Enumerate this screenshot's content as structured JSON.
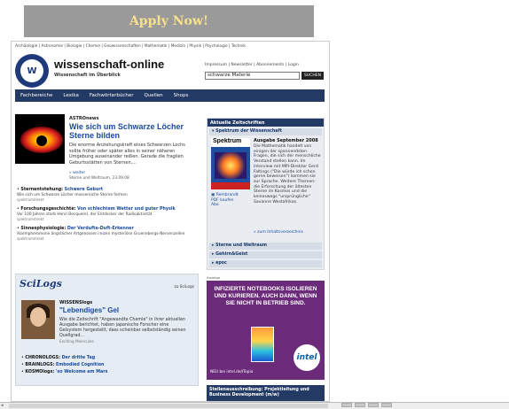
{
  "banner": {
    "label": "Apply Now!"
  },
  "top_links": "Archäologie | Astronomie | Biologie | Chemie | Geowissenschaften | Mathematik | Medizin | Physik | Psychologie | Technik",
  "brand": {
    "logo_letter": "W",
    "name": "wissenschaft-online",
    "tagline": "Wissenschaft im Überblick"
  },
  "util_links": "Impressum | Newsletter | Abonnements | Login",
  "search": {
    "value": "schwarze Materie",
    "button": "SUCHEN"
  },
  "nav": [
    "Fachbereiche",
    "Lexika",
    "Fachwörterbücher",
    "Quellen",
    "Shops"
  ],
  "astro": {
    "section": "ASTROnews",
    "headline": "Wie sich um Schwarze Löcher Sterne bilden",
    "teaser": "Die enorme Anziehungskraft eines Schwarzen Lochs sollte früher oder später alles in seiner näheren Umgebung auseinander reißen. Gerade die fragilen Geburtsstätten von Sternen,...",
    "more": "» weiter",
    "source": "Sterne und Weltraum, 23.09.08"
  },
  "news": [
    {
      "category": "Sternentstehung:",
      "title": "Schwere Geburt",
      "desc": "Wie sich um Schwarze Löcher massereiche Sterne formen",
      "source": "spektrumdirekt"
    },
    {
      "category": "Forschungsgeschichte:",
      "title": "Von schlechtem Wetter und guter Physik",
      "desc": "Vor 100 Jahren starb Henri Becquerel, der Entdecker der Radioaktivität",
      "source": "spektrumdirekt"
    },
    {
      "category": "Sinnesphysiologie:",
      "title": "Der Verdufte-Duft-Erkenner",
      "desc": "Alarmpheromone ängstlicher Artgenossen reizen mysteriöse Gruenebergs-Nervenzellen",
      "source": "spektrumdirekt"
    }
  ],
  "sidebar": {
    "title": "Aktuelle Zeitschriften",
    "active": "Spektrum der Wissenschaft",
    "mag_brand": "Spektrum",
    "issue": "Ausgabe September 2008",
    "desc": "Die Mathematik handelt von einigen der spannendsten Fragen, die sich der menschliche Verstand stellen kann. Im Interview mit MPI-Direktor Gerd Faltings (\"Die würde ich schon gerne beweisen\") kommen sie zur Sprache. Weitere Themen: die Erforschung der ältesten Sterne im Kosmos und die keineswegs \"ursprüngliche\" Savanne Westafrikas.",
    "links": [
      "Rembrandt",
      "PDF kaufen",
      "Abo"
    ],
    "toc": "» zum Inhaltsverzeichnis",
    "others": [
      "Sterne und Weltraum",
      "Gehirn&Geist",
      "epoc"
    ]
  },
  "scilogs": {
    "logo": "SciLogs",
    "by": "zu SciLogs",
    "author": "WISSENSlogs",
    "headline": "\"Lebendiges\" Gel",
    "text": "Wie die Zeitschrift \"Angewandte Chemie\" in ihrer aktuellen Ausgabe berichtet, haben japanische Forscher eine Gelsystem hergestellt, dass scheinbar selbstständig seinen Quellgrad...",
    "source": "Exciting Molecules",
    "links": [
      {
        "category": "CHRONOLOGS:",
        "title": "Der dritte Tag"
      },
      {
        "category": "BRAINLOGS:",
        "title": "Embodied Cognition"
      },
      {
        "category": "KOSMOlogs:",
        "title": "'so Welcome am Mars"
      }
    ]
  },
  "ad": {
    "label": "Anzeige",
    "headline": "INFIZIERTE NOTEBOOKS ISOLIEREN UND KURIEREN. AUCH DANN, WENN SIE NICHT IN BETRIEB SIND.",
    "brand": "intel",
    "footer": "NEU bei intel.de/ITopia"
  },
  "jobs": {
    "title": "Stellenausschreibung: Projektleitung und Business Development (m/w)"
  }
}
